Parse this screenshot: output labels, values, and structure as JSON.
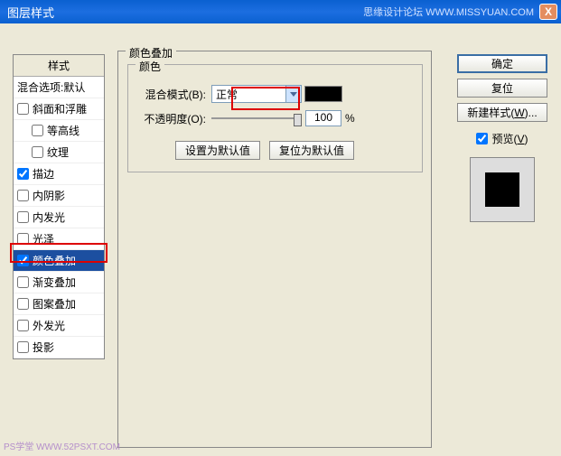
{
  "titlebar": {
    "title": "图层样式",
    "watermark": "思缘设计论坛  WWW.MISSYUAN.COM",
    "close": "X"
  },
  "styles": {
    "header": "样式",
    "blendopts": "混合选项:默认",
    "items": [
      {
        "label": "斜面和浮雕",
        "checked": false
      },
      {
        "label": "等高线",
        "checked": false,
        "indent": true
      },
      {
        "label": "纹理",
        "checked": false,
        "indent": true
      },
      {
        "label": "描边",
        "checked": true
      },
      {
        "label": "内阴影",
        "checked": false
      },
      {
        "label": "内发光",
        "checked": false
      },
      {
        "label": "光泽",
        "checked": false
      },
      {
        "label": "颜色叠加",
        "checked": true,
        "selected": true
      },
      {
        "label": "渐变叠加",
        "checked": false
      },
      {
        "label": "图案叠加",
        "checked": false
      },
      {
        "label": "外发光",
        "checked": false
      },
      {
        "label": "投影",
        "checked": false
      }
    ]
  },
  "panel": {
    "title": "颜色叠加",
    "group_title": "颜色",
    "blend_label": "混合模式(B):",
    "blend_value": "正常",
    "opacity_label": "不透明度(O):",
    "opacity_value": "100",
    "opacity_pct": "%",
    "default_btn": "设置为默认值",
    "reset_btn": "复位为默认值",
    "swatch_color": "#000000"
  },
  "right": {
    "ok": "确定",
    "cancel": "复位",
    "newstyle_pre": "新建样式(",
    "newstyle_key": "W",
    "newstyle_post": ")...",
    "preview_pre": "预览(",
    "preview_key": "V",
    "preview_post": ")"
  },
  "footer": "PS学堂  WWW.52PSXT.COM"
}
